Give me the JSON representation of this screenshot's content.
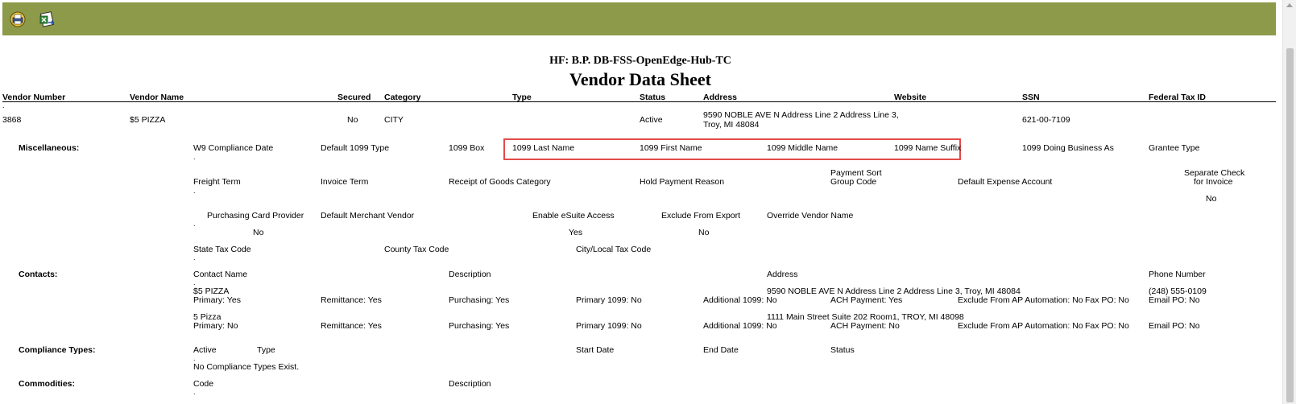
{
  "toolbar": {
    "print_icon": "print-icon",
    "export_icon": "export-excel-icon"
  },
  "report": {
    "subtitle": "HF: B.P. DB-FSS-OpenEdge-Hub-TC",
    "title": "Vendor Data Sheet"
  },
  "columns": {
    "vendor_number": "Vendor Number",
    "vendor_name": "Vendor Name",
    "secured": "Secured",
    "category": "Category",
    "type": "Type",
    "status": "Status",
    "address": "Address",
    "website": "Website",
    "ssn": "SSN",
    "federal_tax_id": "Federal Tax ID"
  },
  "vendor": {
    "number": "3868",
    "name": "$5 PIZZA",
    "secured": "No",
    "category": "CITY",
    "status": "Active",
    "address_line1": "9590 NOBLE AVE N Address Line 2 Address Line 3,",
    "address_line2": "Troy, MI 48084",
    "ssn": "621-00-7109"
  },
  "misc": {
    "section": "Miscellaneous:",
    "w9_compliance_date": "W9 Compliance Date",
    "default_1099_type": "Default 1099 Type",
    "box_1099": "1099 Box",
    "last_name_1099": "1099 Last Name",
    "first_name_1099": "1099 First Name",
    "middle_name_1099": "1099 Middle Name",
    "name_suffix_1099": "1099 Name Suffix",
    "doing_business_as_1099": "1099 Doing Business As",
    "grantee_type": "Grantee Type",
    "freight_term": "Freight Term",
    "invoice_term": "Invoice Term",
    "receipt_of_goods_category": "Receipt of Goods Category",
    "hold_payment_reason": "Hold Payment Reason",
    "payment_sort_line1": "Payment Sort",
    "payment_sort_line2": "Group Code",
    "default_expense_account": "Default Expense Account",
    "separate_check_line1": "Separate Check",
    "separate_check_line2": "for Invoice",
    "separate_check_value": "No",
    "purchasing_card_provider": "Purchasing Card Provider",
    "purchasing_card_value": "No",
    "default_merchant_vendor": "Default Merchant Vendor",
    "enable_esuite_access": "Enable eSuite Access",
    "enable_esuite_value": "Yes",
    "exclude_from_export": "Exclude From Export",
    "exclude_from_export_value": "No",
    "override_vendor_name": "Override Vendor Name",
    "state_tax_code": "State Tax Code",
    "county_tax_code": "County Tax Code",
    "city_local_tax_code": "City/Local Tax Code"
  },
  "contacts": {
    "section": "Contacts:",
    "col_contact_name": "Contact Name",
    "col_description": "Description",
    "col_address": "Address",
    "col_phone": "Phone Number",
    "rows": [
      {
        "name": "$5 PIZZA",
        "primary": "Primary: Yes",
        "remittance": "Remittance: Yes",
        "purchasing": "Purchasing: Yes",
        "primary_1099": "Primary 1099: No",
        "additional_1099": "Additional 1099: No",
        "address": "9590 NOBLE AVE N Address Line 2 Address Line 3, Troy, MI 48084",
        "ach": "ACH Payment: Yes",
        "exclude_ap": "Exclude From AP Automation: No",
        "fax_po": "Fax PO: No",
        "phone": "(248) 555-0109",
        "email_po": "Email PO: No"
      },
      {
        "name": "5 Pizza",
        "primary": "Primary: No",
        "remittance": "Remittance: Yes",
        "purchasing": "Purchasing: Yes",
        "primary_1099": "Primary 1099: No",
        "additional_1099": "Additional 1099: No",
        "address": "1111 Main Street Suite 202 Room1, TROY, MI 48098",
        "ach": "ACH Payment: No",
        "exclude_ap": "Exclude From AP Automation: No",
        "fax_po": "Fax PO: No",
        "phone": "",
        "email_po": "Email PO: No"
      }
    ]
  },
  "compliance": {
    "section": "Compliance Types:",
    "col_active": "Active",
    "col_type": "Type",
    "col_start_date": "Start Date",
    "col_end_date": "End Date",
    "col_status": "Status",
    "empty_message": "No Compliance Types Exist."
  },
  "commodities": {
    "section": "Commodities:",
    "col_code": "Code",
    "col_description": "Description"
  },
  "colors": {
    "toolbar": "#8c9a49",
    "highlight": "#e34a4a"
  }
}
